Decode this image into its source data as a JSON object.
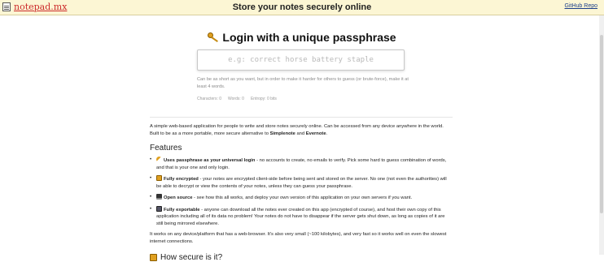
{
  "header": {
    "logo_text": "notepad.mx",
    "title": "Store your notes securely online",
    "github_link": "GitHub Repo"
  },
  "login": {
    "title": "Login with a unique passphrase",
    "placeholder": "e.g: correct horse battery staple",
    "hint": "Can be as short as you want, but in order to make it harder for others to guess (or brute-force), make it at least 4 words.",
    "characters": "Characters: 0",
    "words": "Words: 0",
    "entropy": "Entropy: 0 bits"
  },
  "intro": {
    "text": "A simple web-based application for people to write and store notes securely online. Can be accessed from any device anywhere in the world. Built to be as a more portable, more secure alternative to ",
    "simplenote": "Simplenote",
    "and": " and ",
    "evernote": "Evernote",
    "end": "."
  },
  "features": {
    "heading": "Features",
    "items": [
      {
        "icon": "key-icon",
        "title": "Uses passphrase as your universal login",
        "text": " - no accounts to create, no emails to verify. Pick some hard to guess combination of words, and that is your one and only login."
      },
      {
        "icon": "lock-icon",
        "title": "Fully encrypted",
        "text": " - your notes are encrypted client-side before being sent and stored on the server. No one (not even the authorities) will be able to decrypt or view the contents of your notes, unless they can guess your passphrase."
      },
      {
        "icon": "laptop-icon",
        "title": "Open source",
        "text": " - see how this all works, and deploy your own version of this application on your own servers if you want."
      },
      {
        "icon": "floppy-disk-icon",
        "title": "Fully exportable",
        "text": " - anyone can download all the notes ever created on this app (encrypted of course), and host their own copy of this application including all of its data no problem! Your notes do not have to disappear if the server gets shut down, as long as copies of it are still being mirrored elsewhere."
      }
    ]
  },
  "works_text": "It works on any device/platform that has a web-browser. It's also very small (~100 kilobytes), and very fast so it works well on even the slowest internet connections.",
  "how_secure": {
    "heading": "How secure is it?"
  },
  "colors": {
    "topbar_bg": "#fcf6d4",
    "logo_red": "#cc2a2a",
    "link_blue": "#1b3e8a",
    "key_gold": "#e0a020"
  }
}
